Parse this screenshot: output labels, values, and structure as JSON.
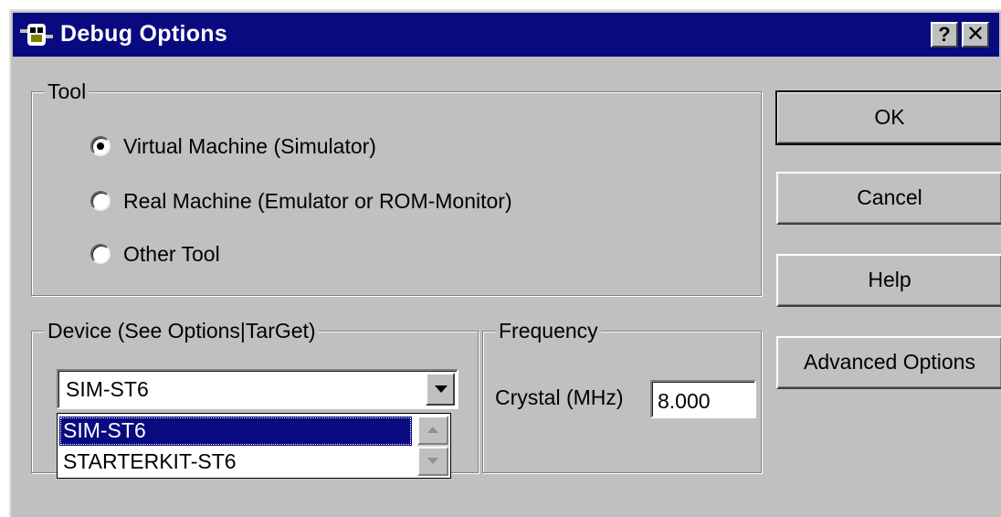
{
  "window": {
    "title": "Debug Options",
    "help_button": "?",
    "close_button": "✕"
  },
  "tool_group": {
    "legend": "Tool",
    "options": [
      {
        "label": "Virtual Machine (Simulator)",
        "selected": true
      },
      {
        "label": "Real Machine (Emulator or ROM-Monitor)",
        "selected": false
      },
      {
        "label": "Other Tool",
        "selected": false
      }
    ]
  },
  "buttons": {
    "ok": "OK",
    "cancel": "Cancel",
    "help": "Help",
    "advanced": "Advanced Options"
  },
  "device_group": {
    "legend": "Device (See Options|TarGet)",
    "selected": "SIM-ST6",
    "list": [
      "SIM-ST6",
      "STARTERKIT-ST6"
    ]
  },
  "frequency_group": {
    "legend": "Frequency",
    "crystal_label": "Crystal (MHz)",
    "crystal_value": "8.000"
  },
  "colors": {
    "titlebar": "#0a0a80",
    "face": "#c0c0c0",
    "selection": "#0a0a80"
  }
}
